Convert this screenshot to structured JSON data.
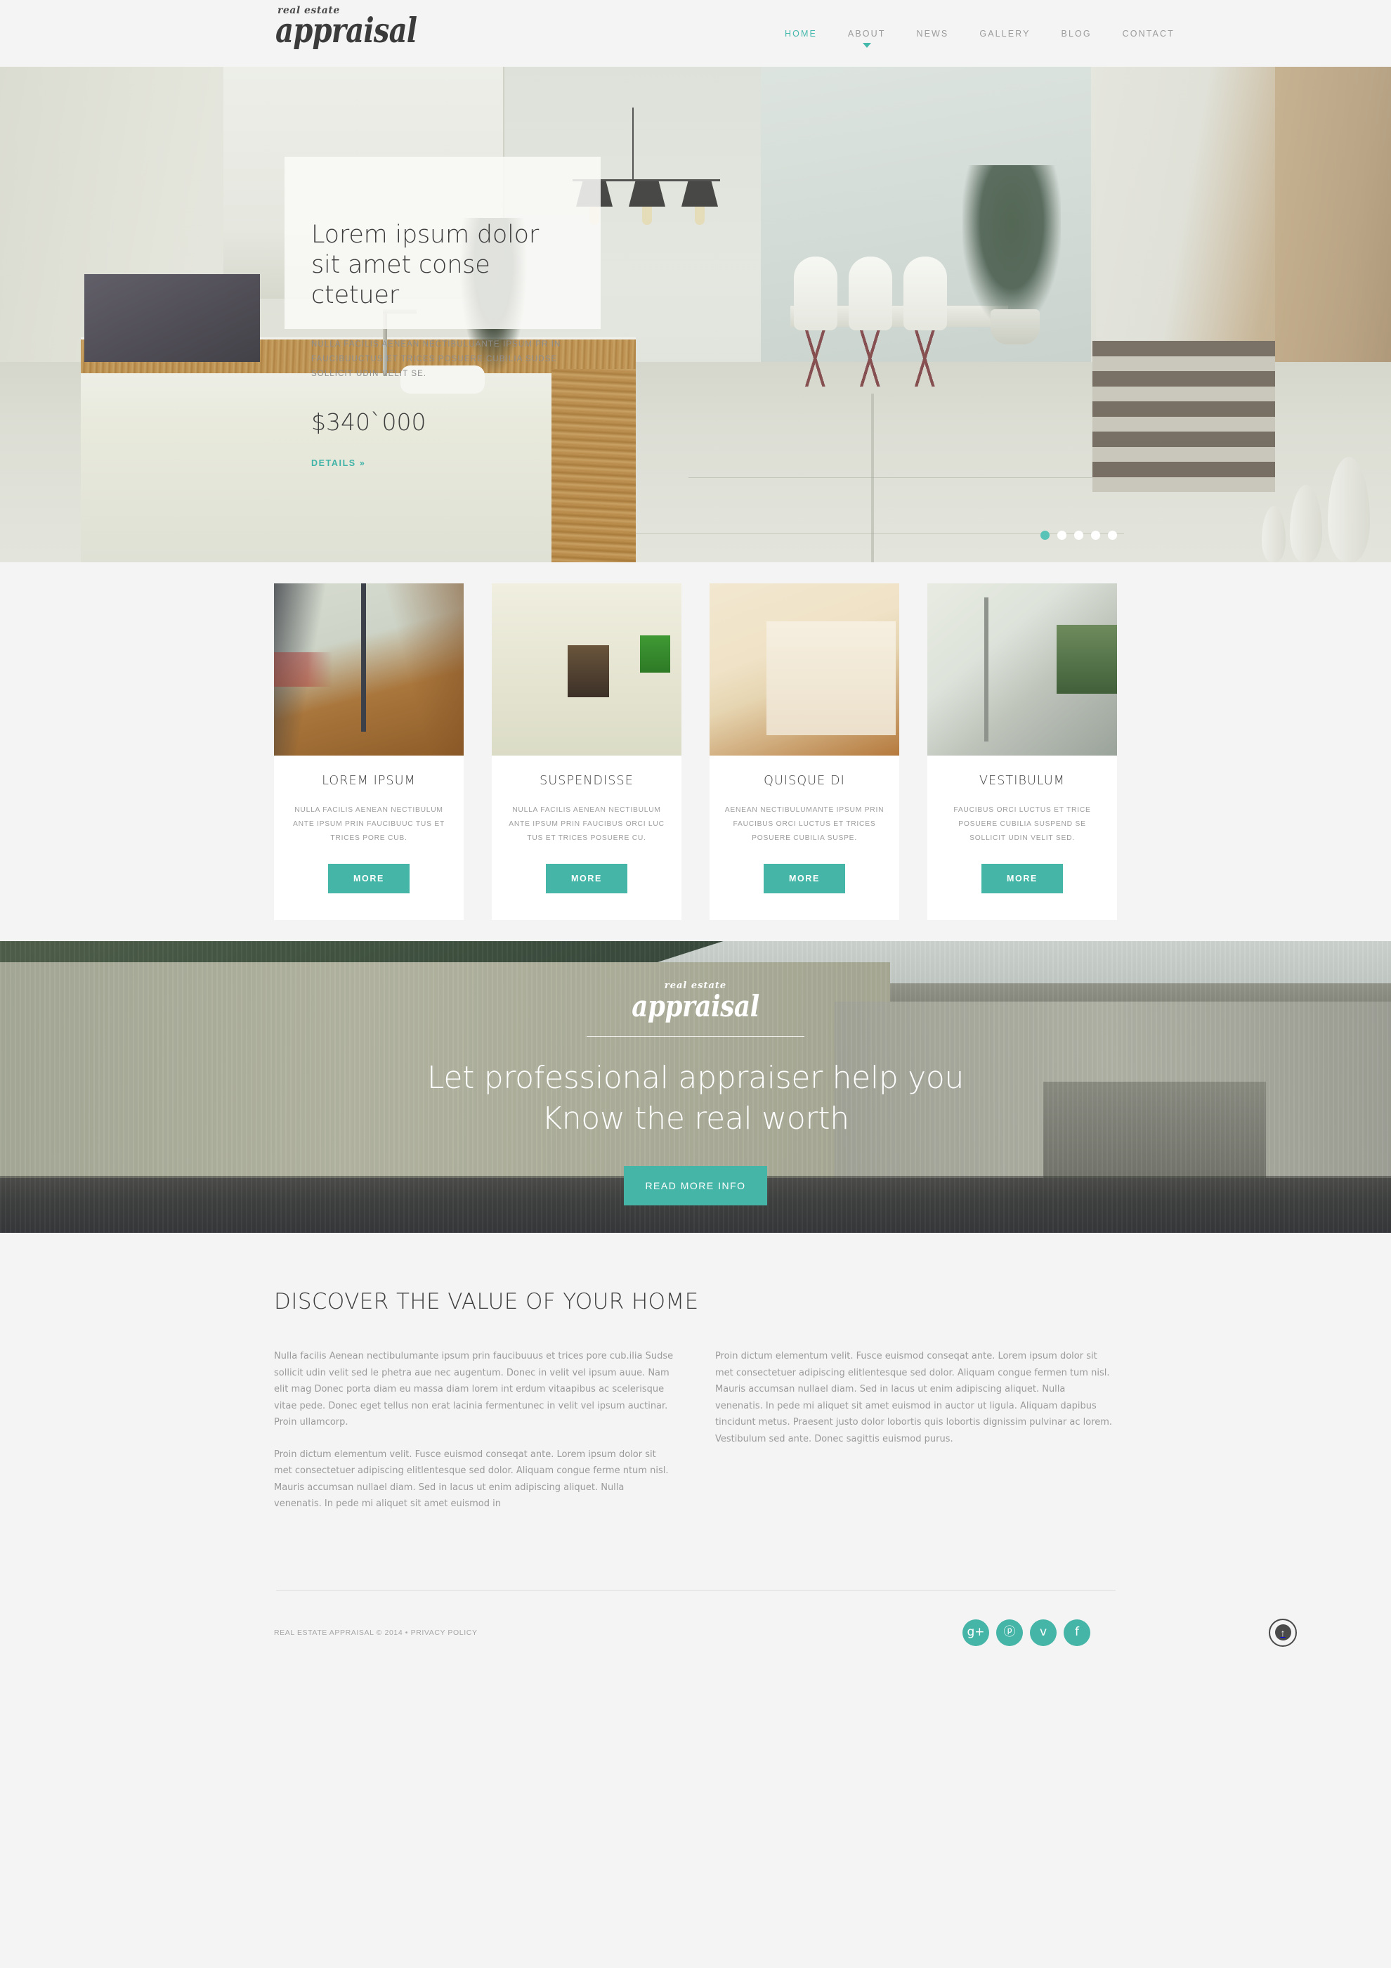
{
  "brand": {
    "sub": "real estate",
    "main": "appraisal"
  },
  "nav": {
    "items": [
      {
        "label": "HOME",
        "active": true,
        "caret": false
      },
      {
        "label": "ABOUT",
        "active": false,
        "caret": true
      },
      {
        "label": "NEWS",
        "active": false,
        "caret": false
      },
      {
        "label": "GALLERY",
        "active": false,
        "caret": false
      },
      {
        "label": "BLOG",
        "active": false,
        "caret": false
      },
      {
        "label": "CONTACT",
        "active": false,
        "caret": false
      }
    ]
  },
  "hero": {
    "title": "Lorem ipsum dolor sit amet conse ctetuer",
    "description": "NULLA FACILIS AENEAN NECTIBULUANTE IPSUM PR IN FAUCIBUUCTUS ET TRICES POSUERE CUBILIA SUDSE SOLLICIT UDIN VELIT SE.",
    "price": "$340`000",
    "details_label": "DETAILS »",
    "slides_total": 5,
    "active_slide": 1
  },
  "cards": [
    {
      "title": "LOREM IPSUM",
      "desc": "NULLA FACILIS AENEAN NECTIBULUM ANTE IPSUM PRIN FAUCIBUUC TUS ET TRICES PORE CUB.",
      "button": "MORE",
      "photo": "sliding-glass-door-terrace"
    },
    {
      "title": "SUSPENDISSE",
      "desc": "NULLA FACILIS AENEAN NECTIBULUM ANTE IPSUM PRIN FAUCIBUS ORCI LUC TUS ET TRICES POSUERE CU.",
      "button": "MORE",
      "photo": "white-corridor-green-alcove"
    },
    {
      "title": "QUISQUE DI",
      "desc": "AENEAN NECTIBULUMANTE IPSUM PRIN FAUCIBUS ORCI LUCTUS ET TRICES POSUERE CUBILIA SUSPE.",
      "button": "MORE",
      "photo": "attic-room-wooden-floor"
    },
    {
      "title": "VESTIBULUM",
      "desc": "FAUCIBUS ORCI LUCTUS ET TRICE POSUERE CUBILIA SUSPEND SE SOLLICIT UDIN VELIT SED.",
      "button": "MORE",
      "photo": "balcony-glass-door-mountain"
    }
  ],
  "cta": {
    "logo_sub": "real estate",
    "logo_main": "appraisal",
    "headline_line1": "Let professional appraiser help you",
    "headline_line2": "Know the real worth",
    "button": "READ MORE INFO"
  },
  "article": {
    "title": "DISCOVER THE VALUE OF YOUR HOME",
    "left_paragraphs": [
      "Nulla facilis Aenean nectibulumante ipsum prin faucibuuus et trices pore cub.ilia Sudse sollicit udin velit sed le phetra aue nec augentum. Donec in velit vel ipsum auue. Nam elit mag Donec porta diam eu massa diam lorem int erdum vitaapibus ac scelerisque vitae pede. Donec eget tellus non erat lacinia fermentunec in velit vel ipsum auctinar. Proin ullamcorp.",
      "Proin dictum elementum velit. Fusce euismod conseqat ante. Lorem ipsum dolor sit met consectetuer adipiscing elitlentesque sed dolor. Aliquam congue ferme ntum nisl. Mauris accumsan nullael diam. Sed in lacus ut enim adipiscing aliquet. Nulla venenatis. In pede mi aliquet sit amet euismod in"
    ],
    "right_paragraphs": [
      "Proin dictum elementum velit. Fusce euismod conseqat ante. Lorem ipsum dolor sit met consectetuer adipiscing elitlentesque sed dolor. Aliquam congue fermen tum nisl. Mauris accumsan nullael diam. Sed in lacus ut enim adipiscing aliquet. Nulla venenatis. In pede mi aliquet sit amet euismod in auctor ut ligula. Aliquam dapibus tincidunt metus. Praesent justo dolor lobortis quis lobortis dignissim pulvinar ac lorem. Vestibulum sed ante. Donec sagittis euismod purus."
    ]
  },
  "footer": {
    "copyright": "REAL ESTATE APPRAISAL  © 2014 • PRIVACY POLICY",
    "socials": [
      {
        "name": "google-plus",
        "glyph": "g+"
      },
      {
        "name": "pinterest",
        "glyph": "ⓟ"
      },
      {
        "name": "twitter",
        "glyph": "ᴠ"
      },
      {
        "name": "facebook",
        "glyph": "f"
      }
    ],
    "back_to_top": "↑"
  },
  "colors": {
    "accent": "#45b5a7",
    "accent_light": "#58c3b6",
    "text_dark": "#3d3d3d",
    "text_muted": "#9a9a9a",
    "page_bg": "#f4f4f4"
  }
}
